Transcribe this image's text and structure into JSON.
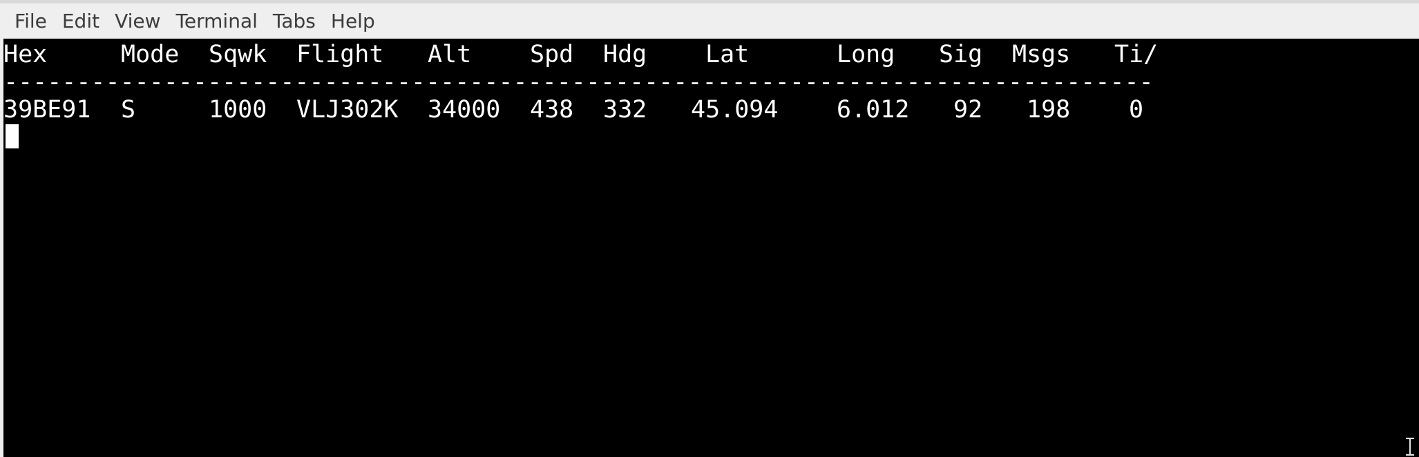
{
  "menubar": {
    "items": [
      "File",
      "Edit",
      "View",
      "Terminal",
      "Tabs",
      "Help"
    ]
  },
  "terminal": {
    "columns": [
      "Hex",
      "Mode",
      "Sqwk",
      "Flight",
      "Alt",
      "Spd",
      "Hdg",
      "Lat",
      "Long",
      "Sig",
      "Msgs",
      "Ti/"
    ],
    "separator": "-------------------------------------------------------------------------------",
    "rows": [
      {
        "hex": "39BE91",
        "mode": "S",
        "sqwk": "1000",
        "flight": "VLJ302K",
        "alt": "34000",
        "spd": "438",
        "hdg": "332",
        "lat": "45.094",
        "long": "6.012",
        "sig": "92",
        "msgs": "198",
        "ti": "0"
      }
    ]
  }
}
